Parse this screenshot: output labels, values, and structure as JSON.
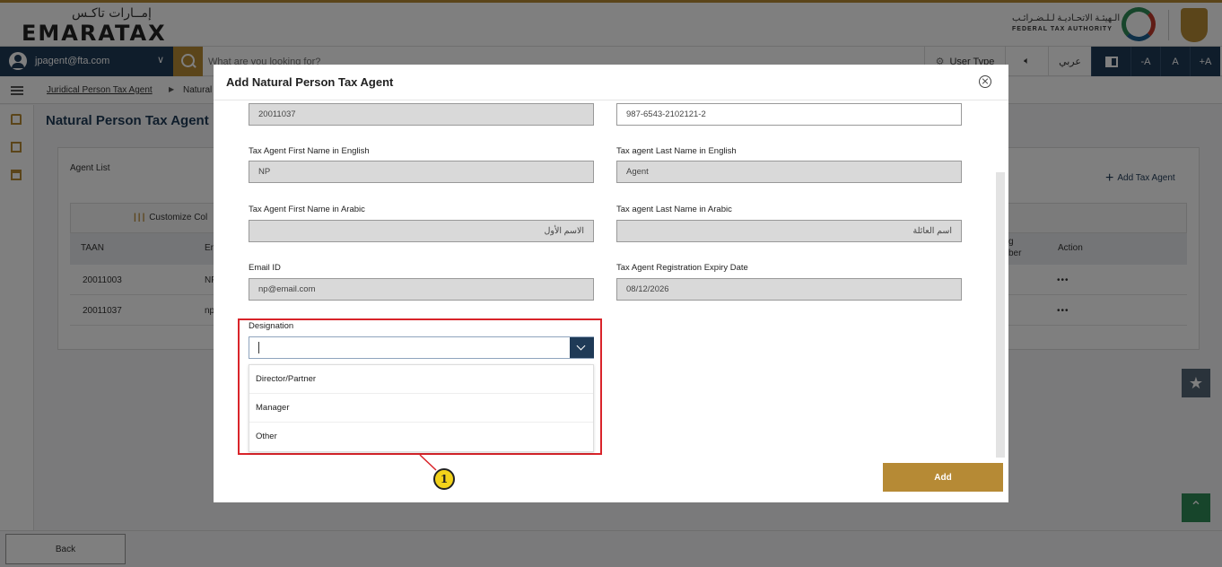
{
  "header": {
    "logo_arabic": "إمــارات تاكـس",
    "logo_english": "EMARATAX",
    "authority_arabic": "الـهيئـة الاتحـاديـة لـلـضـرائـب",
    "authority_english": "FEDERAL TAX AUTHORITY"
  },
  "navbar": {
    "user_email": "jpagent@fta.com",
    "search_placeholder": "What are you looking for?",
    "user_type_label": "User Type",
    "language_label": "عربي",
    "font_decrease": "-A",
    "font_normal": "A",
    "font_increase": "+A"
  },
  "breadcrumb": {
    "item1": "Juridical Person Tax Agent",
    "item2": "Natural"
  },
  "page": {
    "title": "Natural Person Tax Agent",
    "agent_list_label": "Agent List",
    "add_tax_agent": "Add Tax Agent",
    "customize_label": "Customize Col",
    "columns": {
      "taan": "TAAN",
      "email_partial": "En",
      "number_partial_1": "g",
      "number_partial_2": "ber",
      "action": "Action"
    },
    "rows": [
      {
        "taan": "20011003",
        "email_partial": "NP",
        "action": "•••"
      },
      {
        "taan": "20011037",
        "email_partial": "np",
        "action": "•••"
      }
    ],
    "back_button": "Back"
  },
  "modal": {
    "title": "Add Natural Person Tax Agent",
    "fields": {
      "taan_value": "20011037",
      "registration_number_value": "987-6543-2102121-2",
      "first_name_en_label": "Tax Agent First Name in English",
      "first_name_en_value": "NP",
      "last_name_en_label": "Tax agent Last Name in English",
      "last_name_en_value": "Agent",
      "first_name_ar_label": "Tax Agent First Name in Arabic",
      "first_name_ar_value": "الاسم الأول",
      "last_name_ar_label": "Tax agent Last Name in Arabic",
      "last_name_ar_value": "اسم العائلة",
      "email_label": "Email ID",
      "email_value": "np@email.com",
      "expiry_label": "Tax Agent Registration Expiry Date",
      "expiry_value": "08/12/2026",
      "designation_label": "Designation"
    },
    "designation_options": [
      "Director/Partner",
      "Manager",
      "Other"
    ],
    "add_button": "Add"
  },
  "annotation": {
    "callout_number": "1",
    "highlight_color": "#d9242a"
  },
  "colors": {
    "navy": "#1f3a57",
    "gold": "#b68a35",
    "green": "#2e8b57"
  },
  "icons": [
    "avatar-icon",
    "search-icon",
    "gear-icon",
    "speaker-icon",
    "contrast-icon",
    "hamburger-icon",
    "home-icon",
    "clipboard-icon",
    "bank-icon",
    "plus-icon",
    "close-icon",
    "chevron-down-icon",
    "star-icon",
    "chevron-up-icon"
  ]
}
